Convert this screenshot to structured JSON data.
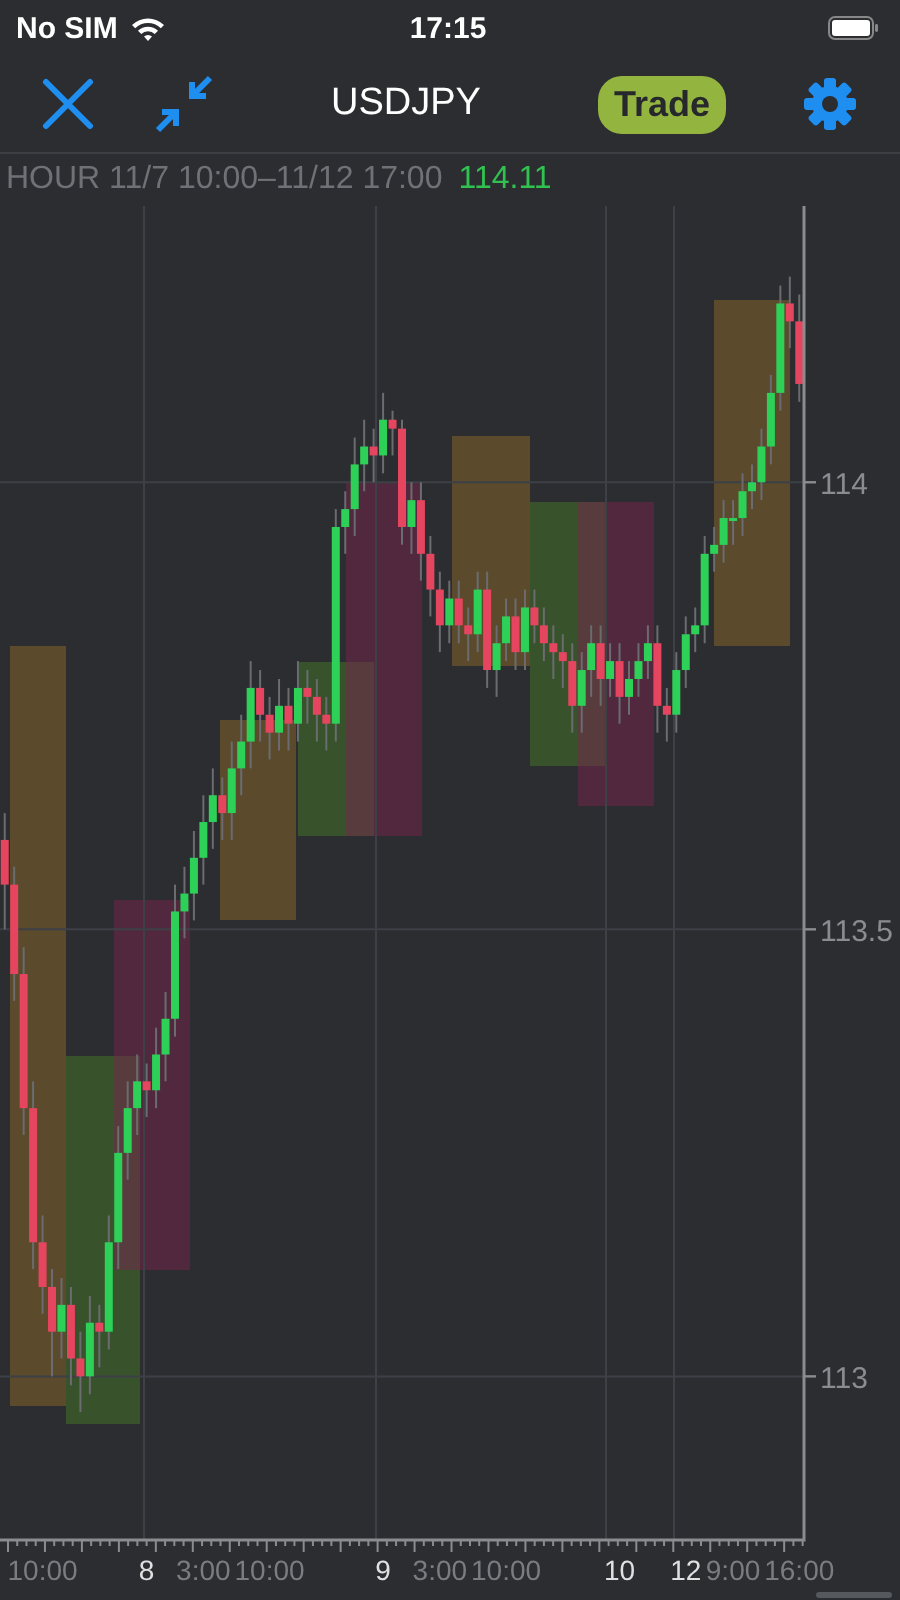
{
  "status_bar": {
    "carrier": "No SIM",
    "time": "17:15"
  },
  "nav_bar": {
    "title": "USDJPY",
    "trade_button": "Trade"
  },
  "info": {
    "range": "HOUR 11/7 10:00–11/12 17:00",
    "price": "114.11"
  },
  "chart": {
    "x_label_highlighted": [
      false,
      true,
      false,
      false,
      true,
      false,
      false,
      true,
      true,
      false,
      false
    ],
    "chart_data": {
      "type": "candlestick",
      "grid": true,
      "ylim": [
        112.817,
        114.309
      ],
      "yticks": [
        {
          "value": 114,
          "label": "114"
        },
        {
          "value": 113.5,
          "label": "113.5"
        },
        {
          "value": 113,
          "label": "113"
        }
      ],
      "categories": [
        null,
        null,
        null,
        null,
        "10:00",
        null,
        null,
        null,
        null,
        null,
        null,
        null,
        null,
        null,
        null,
        "8",
        null,
        null,
        null,
        null,
        null,
        "3:00",
        null,
        null,
        null,
        null,
        null,
        null,
        "10:00",
        null,
        null,
        null,
        null,
        null,
        null,
        null,
        null,
        null,
        null,
        null,
        "9",
        null,
        null,
        null,
        null,
        null,
        "3:00",
        null,
        null,
        null,
        null,
        null,
        null,
        "10:00",
        null,
        null,
        null,
        null,
        null,
        null,
        null,
        null,
        null,
        null,
        null,
        "10",
        null,
        null,
        null,
        null,
        null,
        null,
        "12",
        null,
        null,
        null,
        null,
        "9:00",
        null,
        null,
        null,
        null,
        null,
        null,
        "16:00"
      ],
      "ohlc": [
        [
          113.6,
          113.63,
          113.5,
          113.55
        ],
        [
          113.55,
          113.57,
          113.42,
          113.45
        ],
        [
          113.45,
          113.48,
          113.27,
          113.3
        ],
        [
          113.3,
          113.33,
          113.12,
          113.15
        ],
        [
          113.15,
          113.18,
          113.07,
          113.1
        ],
        [
          113.1,
          113.12,
          113.0,
          113.05
        ],
        [
          113.05,
          113.11,
          113.02,
          113.08
        ],
        [
          113.08,
          113.1,
          112.99,
          113.02
        ],
        [
          113.02,
          113.05,
          112.96,
          113.0
        ],
        [
          113.0,
          113.09,
          112.98,
          113.06
        ],
        [
          113.06,
          113.08,
          113.01,
          113.05
        ],
        [
          113.05,
          113.18,
          113.03,
          113.15
        ],
        [
          113.15,
          113.28,
          113.12,
          113.25
        ],
        [
          113.25,
          113.33,
          113.22,
          113.3
        ],
        [
          113.3,
          113.36,
          113.27,
          113.33
        ],
        [
          113.33,
          113.35,
          113.29,
          113.32
        ],
        [
          113.32,
          113.39,
          113.3,
          113.36
        ],
        [
          113.36,
          113.43,
          113.33,
          113.4
        ],
        [
          113.4,
          113.55,
          113.38,
          113.52
        ],
        [
          113.52,
          113.57,
          113.49,
          113.54
        ],
        [
          113.54,
          113.61,
          113.51,
          113.58
        ],
        [
          113.58,
          113.65,
          113.55,
          113.62
        ],
        [
          113.62,
          113.68,
          113.59,
          113.65
        ],
        [
          113.65,
          113.67,
          113.6,
          113.63
        ],
        [
          113.63,
          113.71,
          113.6,
          113.68
        ],
        [
          113.68,
          113.74,
          113.65,
          113.71
        ],
        [
          113.71,
          113.8,
          113.68,
          113.77
        ],
        [
          113.77,
          113.79,
          113.71,
          113.74
        ],
        [
          113.74,
          113.76,
          113.69,
          113.72
        ],
        [
          113.72,
          113.78,
          113.7,
          113.75
        ],
        [
          113.75,
          113.77,
          113.7,
          113.73
        ],
        [
          113.73,
          113.8,
          113.71,
          113.77
        ],
        [
          113.77,
          113.79,
          113.73,
          113.76
        ],
        [
          113.76,
          113.78,
          113.71,
          113.74
        ],
        [
          113.74,
          113.76,
          113.7,
          113.73
        ],
        [
          113.73,
          113.97,
          113.71,
          113.95
        ],
        [
          113.95,
          113.99,
          113.92,
          113.97
        ],
        [
          113.97,
          114.05,
          113.94,
          114.02
        ],
        [
          114.02,
          114.07,
          113.99,
          114.04
        ],
        [
          114.04,
          114.06,
          114.0,
          114.03
        ],
        [
          114.03,
          114.1,
          114.01,
          114.07
        ],
        [
          114.07,
          114.08,
          114.03,
          114.06
        ],
        [
          114.06,
          114.07,
          113.93,
          113.95
        ],
        [
          113.95,
          114.0,
          113.92,
          113.98
        ],
        [
          113.98,
          114.0,
          113.89,
          113.92
        ],
        [
          113.92,
          113.94,
          113.85,
          113.88
        ],
        [
          113.88,
          113.9,
          113.81,
          113.84
        ],
        [
          113.84,
          113.89,
          113.82,
          113.87
        ],
        [
          113.87,
          113.89,
          113.82,
          113.84
        ],
        [
          113.84,
          113.86,
          113.8,
          113.83
        ],
        [
          113.83,
          113.9,
          113.81,
          113.88
        ],
        [
          113.88,
          113.9,
          113.77,
          113.79
        ],
        [
          113.79,
          113.84,
          113.76,
          113.82
        ],
        [
          113.82,
          113.87,
          113.8,
          113.85
        ],
        [
          113.85,
          113.87,
          113.79,
          113.81
        ],
        [
          113.81,
          113.88,
          113.79,
          113.86
        ],
        [
          113.86,
          113.88,
          113.82,
          113.84
        ],
        [
          113.84,
          113.86,
          113.8,
          113.82
        ],
        [
          113.82,
          113.84,
          113.78,
          113.81
        ],
        [
          113.81,
          113.83,
          113.77,
          113.8
        ],
        [
          113.8,
          113.82,
          113.72,
          113.75
        ],
        [
          113.75,
          113.81,
          113.72,
          113.79
        ],
        [
          113.79,
          113.84,
          113.76,
          113.82
        ],
        [
          113.82,
          113.84,
          113.75,
          113.78
        ],
        [
          113.78,
          113.82,
          113.76,
          113.8
        ],
        [
          113.8,
          113.82,
          113.73,
          113.76
        ],
        [
          113.76,
          113.8,
          113.74,
          113.78
        ],
        [
          113.78,
          113.82,
          113.76,
          113.8
        ],
        [
          113.8,
          113.84,
          113.78,
          113.82
        ],
        [
          113.82,
          113.84,
          113.72,
          113.75
        ],
        [
          113.75,
          113.77,
          113.71,
          113.74
        ],
        [
          113.74,
          113.81,
          113.72,
          113.79
        ],
        [
          113.79,
          113.85,
          113.77,
          113.83
        ],
        [
          113.83,
          113.86,
          113.81,
          113.84
        ],
        [
          113.84,
          113.94,
          113.82,
          113.92
        ],
        [
          113.92,
          113.95,
          113.9,
          113.93
        ],
        [
          113.93,
          113.98,
          113.91,
          113.96
        ],
        [
          113.96,
          113.98,
          113.93,
          113.96
        ],
        [
          113.96,
          114.01,
          113.94,
          113.99
        ],
        [
          113.99,
          114.02,
          113.97,
          114.0
        ],
        [
          114.0,
          114.06,
          113.98,
          114.04
        ],
        [
          114.04,
          114.12,
          114.02,
          114.1
        ],
        [
          114.1,
          114.22,
          114.08,
          114.2
        ],
        [
          114.2,
          114.23,
          114.15,
          114.18
        ],
        [
          114.18,
          114.21,
          114.09,
          114.11
        ]
      ]
    }
  }
}
